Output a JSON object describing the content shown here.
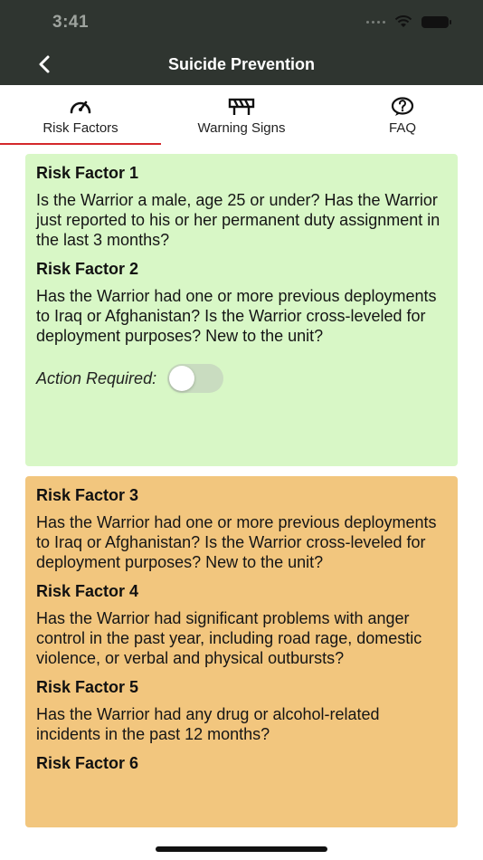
{
  "status_bar": {
    "time": "3:41"
  },
  "nav": {
    "title": "Suicide Prevention"
  },
  "tabs": [
    {
      "label": "Risk Factors",
      "icon": "gauge-icon",
      "active": true
    },
    {
      "label": "Warning Signs",
      "icon": "barrier-icon",
      "active": false
    },
    {
      "label": "FAQ",
      "icon": "question-bubble-icon",
      "active": false
    }
  ],
  "colors": {
    "header_bg": "#2f3530",
    "active_tab_underline": "#d4282b",
    "green_card": "#d8f7c6",
    "orange_card": "#f2c67e"
  },
  "cards": [
    {
      "color": "green",
      "items": [
        {
          "title": "Risk Factor 1",
          "text": "Is the Warrior a male, age 25 or under? Has the Warrior just reported to his or her permanent duty assignment in the last 3 months?"
        },
        {
          "title": "Risk Factor 2",
          "text": "Has the Warrior had one or more previous deployments to Iraq or Afghanistan? Is the Warrior cross-leveled for deployment purposes? New to the unit?"
        }
      ],
      "action": {
        "label": "Action Required:",
        "toggle_on": false
      }
    },
    {
      "color": "orange",
      "items": [
        {
          "title": "Risk Factor 3",
          "text": "Has the Warrior had one or more previous deployments to Iraq or Afghanistan? Is the Warrior cross-leveled for deployment purposes? New to the unit?"
        },
        {
          "title": "Risk Factor 4",
          "text": "Has the Warrior had significant problems with anger control in the past year, including road rage, domestic violence, or verbal and physical outbursts?"
        },
        {
          "title": "Risk Factor 5",
          "text": "Has the Warrior had any drug or alcohol-related incidents in the past 12 months?"
        },
        {
          "title": "Risk Factor 6",
          "text": ""
        }
      ]
    }
  ]
}
